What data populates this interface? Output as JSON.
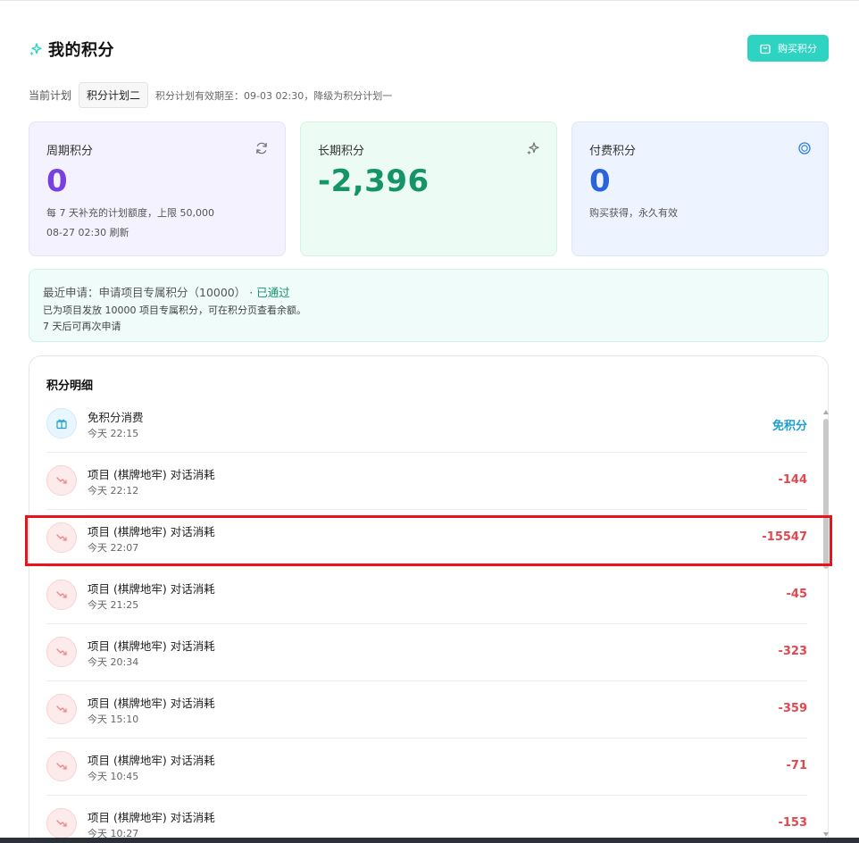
{
  "header": {
    "title": "我的积分",
    "buy_button": "购买积分",
    "title_icon": "sparkle-icon"
  },
  "plan": {
    "label": "当前计划",
    "current": "积分计划二",
    "note": "积分计划有效期至：09-03 02:30，降级为积分计划一"
  },
  "cards": [
    {
      "label": "周期积分",
      "value": "0",
      "desc_1": "每 7 天补充的计划额度，上限 50,000",
      "desc_2": "08-27 02:30 刷新",
      "icon": "refresh-icon",
      "value_color": "#7a3fe0"
    },
    {
      "label": "长期积分",
      "value": "-2,396",
      "icon": "sparkle-icon",
      "value_color": "#149468"
    },
    {
      "label": "付费积分",
      "value": "0",
      "desc_1": "购买获得，永久有效",
      "icon": "coin-icon",
      "value_color": "#2b63db"
    }
  ],
  "notice": {
    "prefix": "最近申请：申请项目专属积分（10000）",
    "separator": " · ",
    "status": "已通过",
    "line2": "已为项目发放 10000 项目专属积分，可在积分页查看余额。",
    "line3": "7 天后可再次申请"
  },
  "details": {
    "title": "积分明细",
    "rows": [
      {
        "name": "免积分消费",
        "time": "今天 22:15",
        "amount": "免积分",
        "icon": "gift-icon"
      },
      {
        "name": "项目 (棋牌地牢) 对话消耗",
        "time": "今天 22:12",
        "amount": "-144",
        "icon": "trend-down-icon"
      },
      {
        "name": "项目 (棋牌地牢) 对话消耗",
        "time": "今天 22:07",
        "amount": "-15547",
        "icon": "trend-down-icon"
      },
      {
        "name": "项目 (棋牌地牢) 对话消耗",
        "time": "今天 21:25",
        "amount": "-45",
        "icon": "trend-down-icon"
      },
      {
        "name": "项目 (棋牌地牢) 对话消耗",
        "time": "今天 20:34",
        "amount": "-323",
        "icon": "trend-down-icon"
      },
      {
        "name": "项目 (棋牌地牢) 对话消耗",
        "time": "今天 15:10",
        "amount": "-359",
        "icon": "trend-down-icon"
      },
      {
        "name": "项目 (棋牌地牢) 对话消耗",
        "time": "今天 10:45",
        "amount": "-71",
        "icon": "trend-down-icon"
      },
      {
        "name": "项目 (棋牌地牢) 对话消耗",
        "time": "今天 10:27",
        "amount": "-153",
        "icon": "trend-down-icon"
      }
    ]
  },
  "colors": {
    "accent": "#2fd3c2",
    "negative": "#e0484f",
    "free": "#1e9fd0",
    "highlight": "#e8141b"
  }
}
